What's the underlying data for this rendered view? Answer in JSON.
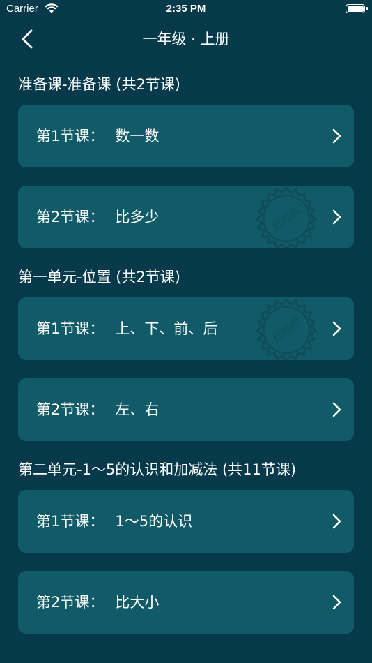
{
  "status_bar": {
    "carrier": "Carrier",
    "time": "2:35 PM"
  },
  "nav": {
    "title": "一年级 · 上册",
    "back_icon": "chevron-left-icon"
  },
  "sections": [
    {
      "title": "准备课-准备课 (共2节课)",
      "lessons": [
        {
          "number": "第1节课：",
          "name": "数一数",
          "completed": false
        },
        {
          "number": "第2节课：",
          "name": "比多少",
          "completed": true,
          "stamp_text": "已完成"
        }
      ]
    },
    {
      "title": "第一单元-位置 (共2节课)",
      "lessons": [
        {
          "number": "第1节课：",
          "name": "上、下、前、后",
          "completed": true,
          "stamp_text": "已完成"
        },
        {
          "number": "第2节课：",
          "name": "左、右",
          "completed": false
        }
      ]
    },
    {
      "title": "第二单元-1～5的认识和加减法 (共11节课)",
      "lessons": [
        {
          "number": "第1节课：",
          "name": "1～5的认识",
          "completed": false
        },
        {
          "number": "第2节课：",
          "name": "比大小",
          "completed": false
        }
      ]
    }
  ],
  "colors": {
    "background": "#063a4b",
    "card": "#115a67",
    "text": "#ffffff"
  }
}
